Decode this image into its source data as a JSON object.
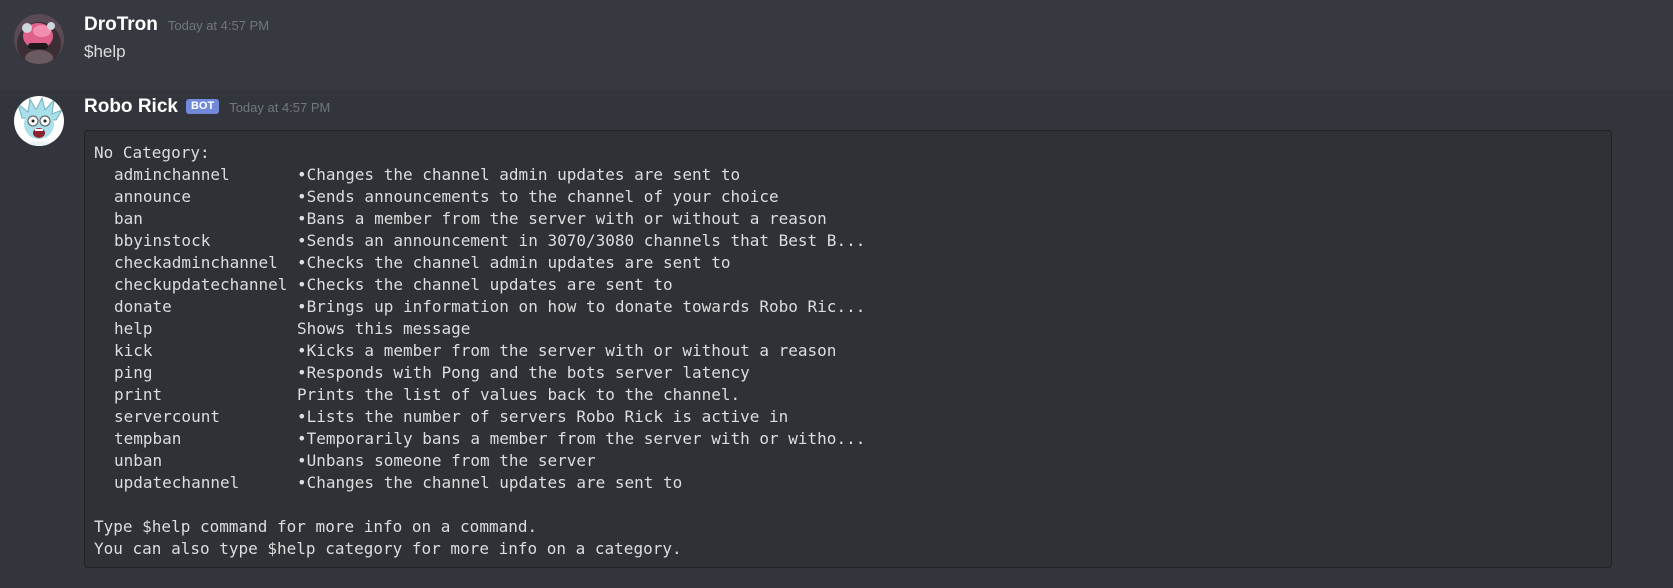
{
  "messages": [
    {
      "username": "DroTron",
      "timestamp": "Today at 4:57 PM",
      "text": "$help"
    },
    {
      "username": "Robo Rick",
      "bot_tag": "BOT",
      "timestamp": "Today at 4:57 PM",
      "code": {
        "category_header": "No Category:",
        "commands": [
          {
            "name": "adminchannel",
            "description": "•Changes the channel admin updates are sent to"
          },
          {
            "name": "announce",
            "description": "•Sends announcements to the channel of your choice"
          },
          {
            "name": "ban",
            "description": "•Bans a member from the server with or without a reason"
          },
          {
            "name": "bbyinstock",
            "description": "•Sends an announcement in 3070/3080 channels that Best B..."
          },
          {
            "name": "checkadminchannel",
            "description": "•Checks the channel admin updates are sent to"
          },
          {
            "name": "checkupdatechannel",
            "description": "•Checks the channel updates are sent to"
          },
          {
            "name": "donate",
            "description": "•Brings up information on how to donate towards Robo Ric..."
          },
          {
            "name": "help",
            "description": "Shows this message"
          },
          {
            "name": "kick",
            "description": "•Kicks a member from the server with or without a reason"
          },
          {
            "name": "ping",
            "description": "•Responds with Pong and the bots server latency"
          },
          {
            "name": "print",
            "description": "Prints the list of values back to the channel."
          },
          {
            "name": "servercount",
            "description": "•Lists the number of servers Robo Rick is active in"
          },
          {
            "name": "tempban",
            "description": "•Temporarily bans a member from the server with or witho..."
          },
          {
            "name": "unban",
            "description": "•Unbans someone from the server"
          },
          {
            "name": "updatechannel",
            "description": "•Changes the channel updates are sent to"
          }
        ],
        "footer_line_1": "Type $help command for more info on a command.",
        "footer_line_2": "You can also type $help category for more info on a category."
      }
    }
  ],
  "colors": {
    "background": "#36393f",
    "hover_background": "#32353b",
    "codeblock_background": "#2f3136",
    "bot_tag": "#7289da",
    "username": "#ffffff",
    "timestamp": "#72767d",
    "text": "#dcddde"
  },
  "icons": {
    "avatar_1": "drotron-avatar-icon",
    "avatar_2": "robo-rick-avatar-icon"
  }
}
